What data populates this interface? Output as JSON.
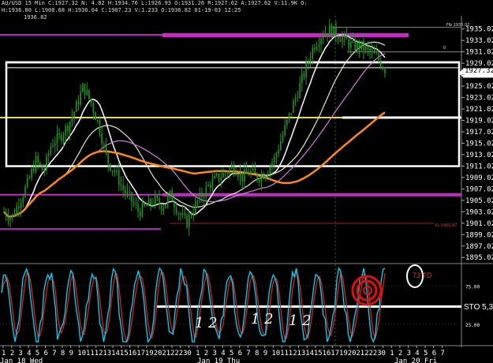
{
  "header": {
    "line1": "AU/USD 15 Min  C:1927.32  N: 4.82  H:1934.76  L:1926.93  O:1931.26  R:1927.62  A:1927.62  V:11.9K  O:",
    "line2": "H:1936.80  L:1908.68  H:1936.04  C:1907.23  V:1.233  O:1936.82  01-19-03 12:25",
    "line3": "1936.82"
  },
  "colors": {
    "background": "#000000",
    "candle": "#1f9a1f",
    "ma_white": "#ffffff",
    "ma_pink": "#d080e0",
    "ma_cream": "#e8e8c0",
    "ma_orange": "#ff8a1a",
    "level_magenta": "#c030c0",
    "level_yellow": "#e8e040",
    "stoch_k": "#00d8ff",
    "stoch_d": "#e02020",
    "annotation_red": "#e01010"
  },
  "annotations": {
    "fib_label": "Fib 1935.02",
    "zero_label": "0",
    "low_label": "XL 1900.87",
    "td_label": "73 TD",
    "sto_label": "STO 5,3",
    "handwritten_1": "1 2",
    "handwritten_2": "1 2",
    "handwritten_3": "1 2",
    "price_box": "1927.32"
  },
  "chart_data": [
    {
      "type": "line",
      "title": "",
      "y_ticks": [
        "1935.02",
        "1933.02",
        "1931.02",
        "1929.02",
        "1927.02",
        "1925.02",
        "1923.02",
        "1921.02",
        "1919.02",
        "1917.02",
        "1915.02",
        "1913.02",
        "1911.02",
        "1909.02",
        "1907.02",
        "1905.02",
        "1903.02",
        "1901.02",
        "1899.02",
        "1897.02",
        "1895.02"
      ],
      "ylim": [
        1894.5,
        1936.5
      ],
      "last_price": 1927.32,
      "levels": [
        {
          "price": 1934.0,
          "color": "magenta"
        },
        {
          "price": 1919.5,
          "color": "yellow"
        },
        {
          "price": 1906.0,
          "color": "magenta"
        },
        {
          "price": 1900.0,
          "color": "magenta"
        }
      ],
      "box": {
        "top": 1929.2,
        "bottom": 1911.0
      },
      "price_series_approx": [
        1903,
        1902,
        1905,
        1908,
        1912,
        1910,
        1915,
        1916,
        1918,
        1921,
        1925,
        1922,
        1918,
        1912,
        1910,
        1907,
        1905,
        1903,
        1904,
        1905,
        1904,
        1906,
        1903,
        1901,
        1904,
        1906,
        1908,
        1909,
        1910,
        1911,
        1909,
        1910,
        1909,
        1910,
        1912,
        1916,
        1920,
        1924,
        1928,
        1932,
        1934,
        1935,
        1934,
        1933,
        1932,
        1932,
        1931,
        1930,
        1928
      ]
    },
    {
      "type": "line",
      "title": "",
      "y_ticks": [
        "75.00",
        "25.00"
      ],
      "ylim": [
        0,
        100
      ],
      "reference_level": 50
    }
  ],
  "x_axis": {
    "hours": [
      "1",
      "2",
      "3",
      "4",
      "5",
      "6",
      "7",
      "8",
      "9",
      "10",
      "11",
      "12",
      "13",
      "14",
      "15",
      "16",
      "17",
      "19",
      "20",
      "21",
      "22",
      "23",
      "0",
      "1",
      "2",
      "3",
      "4",
      "5",
      "6",
      "7",
      "8",
      "9",
      "10",
      "11",
      "12",
      "13",
      "14",
      "15",
      "16",
      "17",
      "19",
      "20",
      "21",
      "22",
      "23",
      "0",
      "1",
      "2",
      "3",
      "4",
      "5",
      "6",
      "7"
    ],
    "day_labels": [
      "Jan 18 Wed",
      "Jan 19 Thu",
      "Jan 20 Fri"
    ]
  }
}
